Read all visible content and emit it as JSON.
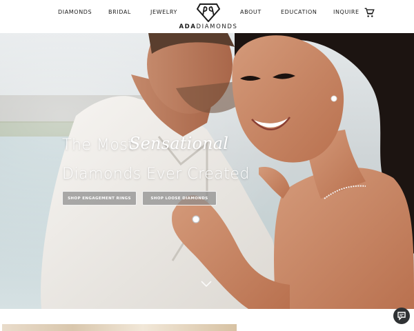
{
  "header": {
    "nav_left": [
      "DIAMONDS",
      "BRIDAL",
      "JEWELRY"
    ],
    "nav_right": [
      "ABOUT",
      "EDUCATION",
      "INQUIRE"
    ],
    "logo_bold": "ADA",
    "logo_thin": "DIAMONDS",
    "cart_icon": "cart-icon"
  },
  "hero": {
    "headline_prefix": "The Most",
    "headline_script": "Sensational",
    "headline_line2": "Diamonds Ever Created",
    "buttons": {
      "engagement": "SHOP ENGAGEMENT RINGS",
      "loose": "SHOP LOOSE DIAMONDS"
    },
    "scroll_icon": "chevron-down-icon"
  },
  "widgets": {
    "chat_icon": "chat-icon"
  }
}
